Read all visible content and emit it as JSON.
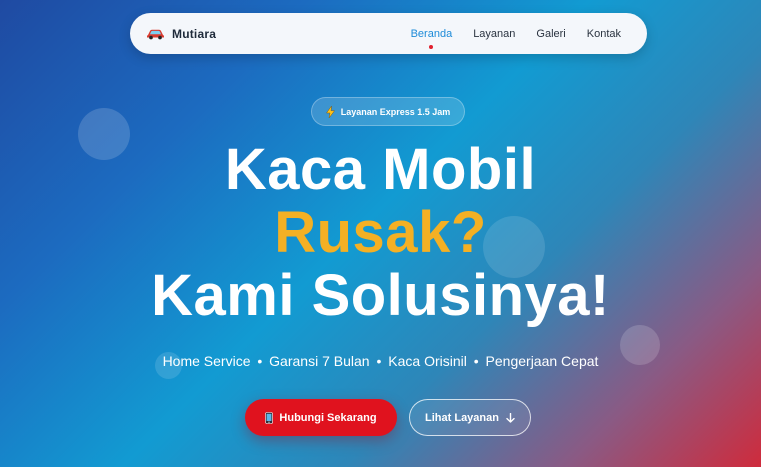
{
  "navbar": {
    "brand_name": "Mutiara",
    "brand_icon": "car-icon",
    "links": [
      {
        "label": "Beranda",
        "active": true
      },
      {
        "label": "Layanan",
        "active": false
      },
      {
        "label": "Galeri",
        "active": false
      },
      {
        "label": "Kontak",
        "active": false
      }
    ]
  },
  "hero": {
    "badge": {
      "icon": "bolt-icon",
      "text": "Layanan Express 1.5 Jam"
    },
    "headline": {
      "line1": "Kaca Mobil",
      "line2": "Rusak?",
      "line3": "Kami Solusinya!"
    },
    "features": [
      "Home Service",
      "Garansi 7 Bulan",
      "Kaca Orisinil",
      "Pengerjaan Cepat"
    ],
    "feature_separator": "•",
    "primary_button": {
      "icon": "phone-icon",
      "label": "Hubungi Sekarang"
    },
    "secondary_button": {
      "label": "Lihat Layanan",
      "icon": "arrow-down-icon"
    }
  },
  "colors": {
    "accent_yellow": "#f4b024",
    "primary_red": "#e0121e",
    "active_link": "#1d8bd8",
    "gradient_start": "#1f4aa2",
    "gradient_mid": "#129bd2",
    "gradient_end": "#cf2b3c"
  }
}
